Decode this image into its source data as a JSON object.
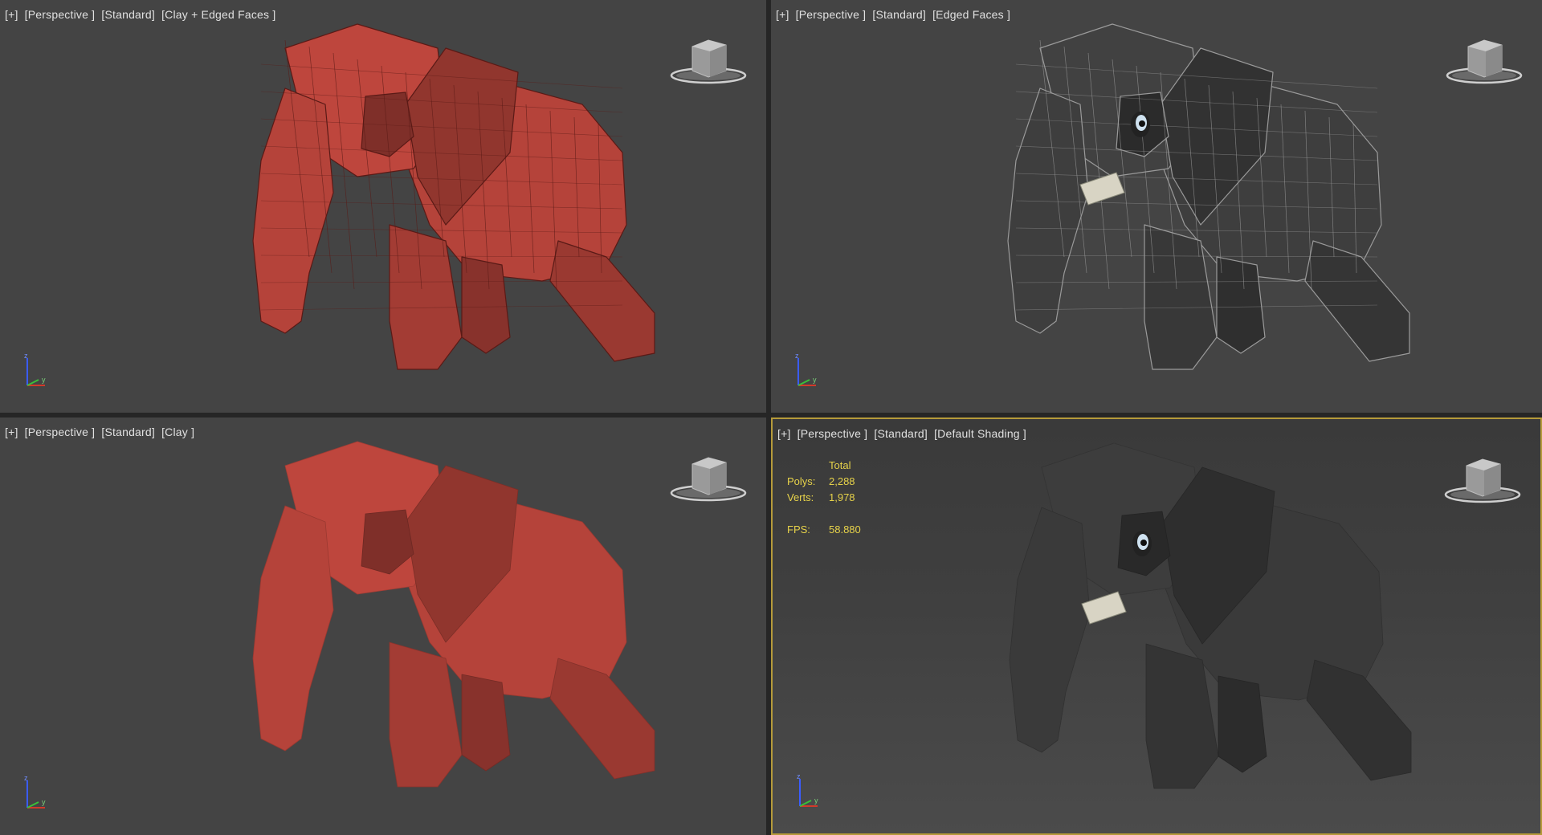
{
  "viewports": [
    {
      "id": "top-left",
      "label": {
        "plus": "[+]",
        "view": "[Perspective ]",
        "mode": "[Standard]",
        "shading": "[Clay + Edged Faces ]"
      },
      "body_color": "#b5433a",
      "edge_color": "#5a1a16",
      "edged": true
    },
    {
      "id": "top-right",
      "label": {
        "plus": "[+]",
        "view": "[Perspective ]",
        "mode": "[Standard]",
        "shading": "[Edged Faces ]"
      },
      "body_color": "#3e3e3e",
      "edge_color": "#9a9a9a",
      "edged": true
    },
    {
      "id": "bottom-left",
      "label": {
        "plus": "[+]",
        "view": "[Perspective ]",
        "mode": "[Standard]",
        "shading": "[Clay ]"
      },
      "body_color": "#b5433a",
      "edge_color": "#b5433a",
      "edged": false
    },
    {
      "id": "bottom-right",
      "label": {
        "plus": "[+]",
        "view": "[Perspective ]",
        "mode": "[Standard]",
        "shading": "[Default Shading ]"
      },
      "body_color": "#3a3a3a",
      "edge_color": "#3a3a3a",
      "edged": false,
      "active": true,
      "stats": {
        "header": "Total",
        "polys_label": "Polys:",
        "polys_value": "2,288",
        "verts_label": "Verts:",
        "verts_value": "1,978",
        "fps_label": "FPS:",
        "fps_value": "58.880"
      }
    }
  ],
  "colors": {
    "viewport_bg": "#444444",
    "active_border": "#b59a3a",
    "stats_text": "#e6d24a",
    "label_text": "#e0e0e0"
  },
  "icons": [
    "viewcube-icon",
    "axis-tripod-icon"
  ]
}
